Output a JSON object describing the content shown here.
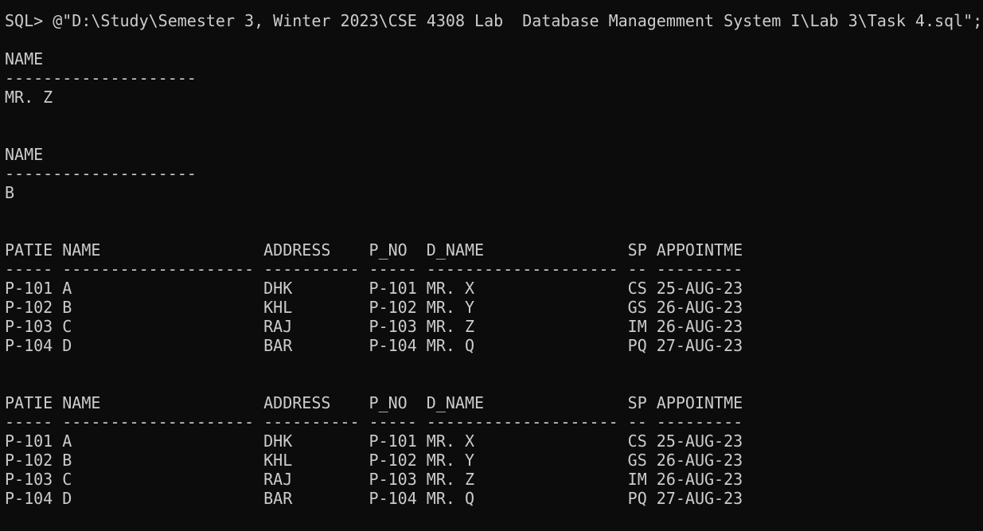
{
  "terminal": {
    "prompt": "SQL> ",
    "command": "@\"D:\\Study\\Semester 3, Winter 2023\\CSE 4308 Lab  Database Managemment System I\\Lab 3\\Task 4.sql\";",
    "colors": {
      "background": "#0c0c0c",
      "text": "#cccccc"
    },
    "results": [
      {
        "header": "NAME",
        "separator": "--------------------",
        "rows": [
          "MR. Z"
        ]
      },
      {
        "header": "NAME",
        "separator": "--------------------",
        "rows": [
          "B"
        ]
      },
      {
        "header": "PATIE NAME                 ADDRESS    P_NO  D_NAME               SP APPOINTME",
        "separator": "----- -------------------- ---------- ----- -------------------- -- ---------",
        "rows": [
          "P-101 A                    DHK        P-101 MR. X                CS 25-AUG-23",
          "P-102 B                    KHL        P-102 MR. Y                GS 26-AUG-23",
          "P-103 C                    RAJ        P-103 MR. Z                IM 26-AUG-23",
          "P-104 D                    BAR        P-104 MR. Q                PQ 27-AUG-23"
        ]
      },
      {
        "header": "PATIE NAME                 ADDRESS    P_NO  D_NAME               SP APPOINTME",
        "separator": "----- -------------------- ---------- ----- -------------------- -- ---------",
        "rows": [
          "P-101 A                    DHK        P-101 MR. X                CS 25-AUG-23",
          "P-102 B                    KHL        P-102 MR. Y                GS 26-AUG-23",
          "P-103 C                    RAJ        P-103 MR. Z                IM 26-AUG-23",
          "P-104 D                    BAR        P-104 MR. Q                PQ 27-AUG-23"
        ]
      }
    ]
  }
}
